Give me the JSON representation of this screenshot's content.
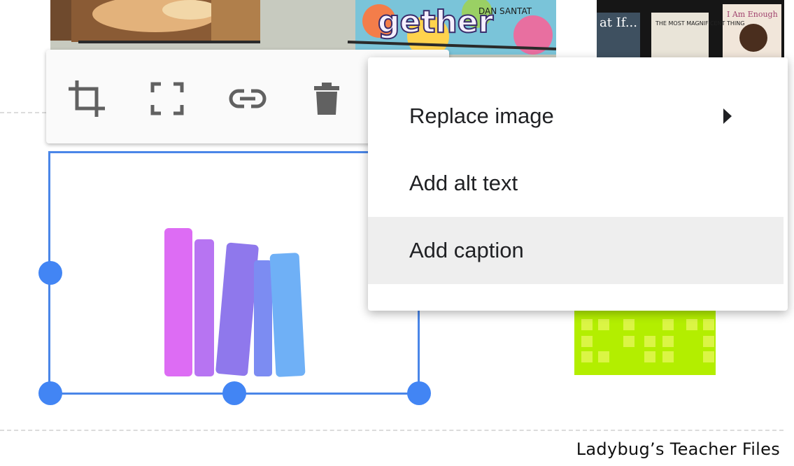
{
  "toolbar": {
    "buttons": [
      {
        "name": "crop-icon",
        "label": "Crop"
      },
      {
        "name": "fullscreen-icon",
        "label": "Reset image"
      },
      {
        "name": "link-icon",
        "label": "Link"
      },
      {
        "name": "trash-icon",
        "label": "Delete"
      }
    ]
  },
  "menu": {
    "items": [
      {
        "label": "Replace image",
        "has_submenu": true
      },
      {
        "label": "Add alt text",
        "has_submenu": false
      },
      {
        "label": "Add caption",
        "has_submenu": false,
        "highlighted": true
      }
    ]
  },
  "books_image": {
    "colors": [
      "#dd6cf4",
      "#b774f2",
      "#8f78ec",
      "#7c8cf2",
      "#6fb0f6"
    ]
  },
  "top_photos": {
    "right_book_titles": [
      "at If...",
      "THE MOST MAGNIFICENT THING",
      "I Am Enough"
    ],
    "left_book_text": "gether",
    "left_author_text": "DAN SANTAT"
  },
  "footer": {
    "credit": "Ladybug’s Teacher Files"
  },
  "colors": {
    "selection_blue": "#4a86e8",
    "handle_blue": "#4285f4",
    "menu_hover": "#eeeeee",
    "green_image": "#b3ee00"
  }
}
